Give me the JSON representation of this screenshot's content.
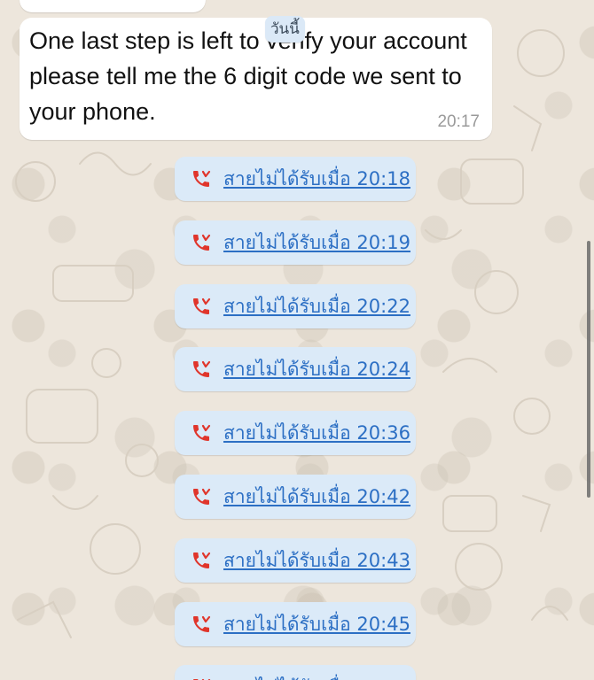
{
  "chat": {
    "date_chip": "วันนี้",
    "message": {
      "text": "One last step is left to verify your account please tell me the 6 digit code we sent to your phone.",
      "time": "20:17"
    },
    "missed_calls": [
      {
        "label": "สายไม่ได้รับเมื่อ 20:18"
      },
      {
        "label": "สายไม่ได้รับเมื่อ 20:19"
      },
      {
        "label": "สายไม่ได้รับเมื่อ 20:22"
      },
      {
        "label": "สายไม่ได้รับเมื่อ 20:24"
      },
      {
        "label": "สายไม่ได้รับเมื่อ 20:36"
      },
      {
        "label": "สายไม่ได้รับเมื่อ 20:42"
      },
      {
        "label": "สายไม่ได้รับเมื่อ 20:43"
      },
      {
        "label": "สายไม่ได้รับเมื่อ 20:45"
      },
      {
        "label": "สายไม่ได้รับเมื่อ"
      }
    ],
    "colors": {
      "background": "#ede6dc",
      "bubble": "#ffffff",
      "call_chip": "#dbeaf8",
      "missed_call_icon": "#e0352b",
      "link_text": "#2c6fc4"
    },
    "icons": {
      "missed_call": "missed-call-icon"
    }
  }
}
